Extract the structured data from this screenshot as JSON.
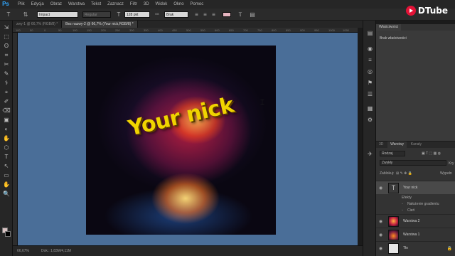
{
  "app": {
    "logo": "Ps"
  },
  "menu": [
    "Plik",
    "Edycja",
    "Obraz",
    "Warstwa",
    "Tekst",
    "Zaznacz",
    "Filtr",
    "3D",
    "Widok",
    "Okno",
    "Pomoc"
  ],
  "options": {
    "tool_icon": "T",
    "orient_icon": "⇅",
    "font_family": "Impact",
    "font_style": "Regular",
    "size_icon": "T",
    "font_size": "128 pkt",
    "aa_label": "aa",
    "aa_value": "Brak",
    "text_color": "#e6b5c0"
  },
  "watermark": {
    "text": "DTube",
    "accent": "#e31337"
  },
  "tabs": [
    {
      "label": "zwy-1 @ 66,7% (RGB/8) *"
    },
    {
      "label": "Bez nazwy-2 @ 66,7% (Your nick,RGB/8) *"
    }
  ],
  "ruler_top": [
    "100",
    "50",
    "0",
    "50",
    "100",
    "150",
    "200",
    "250",
    "300",
    "350",
    "400",
    "450",
    "500",
    "550",
    "600",
    "650",
    "700",
    "750",
    "800",
    "850",
    "900",
    "950",
    "1000",
    "1050"
  ],
  "canvas": {
    "background": "#4a6e98",
    "artwork_text": "Your nick",
    "text_color": "#f0d400"
  },
  "status": {
    "zoom": "66,67%",
    "doc": "Dok.: 1,83M/4,11M"
  },
  "tools": [
    "⇲",
    "⬚",
    "ʘ",
    "⌗",
    "✂",
    "✎",
    "⚕",
    "⌖",
    "✐",
    "⌫",
    "▣",
    "◐",
    "✋",
    "⬡",
    "T",
    "↖",
    "▭",
    "✋",
    "🔍"
  ],
  "dock_icons": [
    "▤",
    "◉",
    "≡",
    "◎",
    "⚑",
    "☰",
    "▦",
    "⚙",
    "✈"
  ],
  "properties": {
    "tab": "Właściwości",
    "empty_label": "Brak właściwości"
  },
  "layers": {
    "tabs": [
      "3D",
      "Warstwy",
      "Kanały"
    ],
    "filter": "Rodzaj",
    "blend_mode": "Zwykły",
    "opacity_label": "Kry",
    "lock_label": "Zablokuj:",
    "fill_label": "Wypełn",
    "items": [
      {
        "name": "Your nick",
        "type": "text"
      },
      {
        "name": "Warstwa 2",
        "type": "image2"
      },
      {
        "name": "Warstwa 1",
        "type": "image1"
      },
      {
        "name": "Tło",
        "type": "bg"
      }
    ],
    "effects_label": "Efekty",
    "effects": [
      "Nałożenie gradientu",
      "Cień"
    ]
  }
}
